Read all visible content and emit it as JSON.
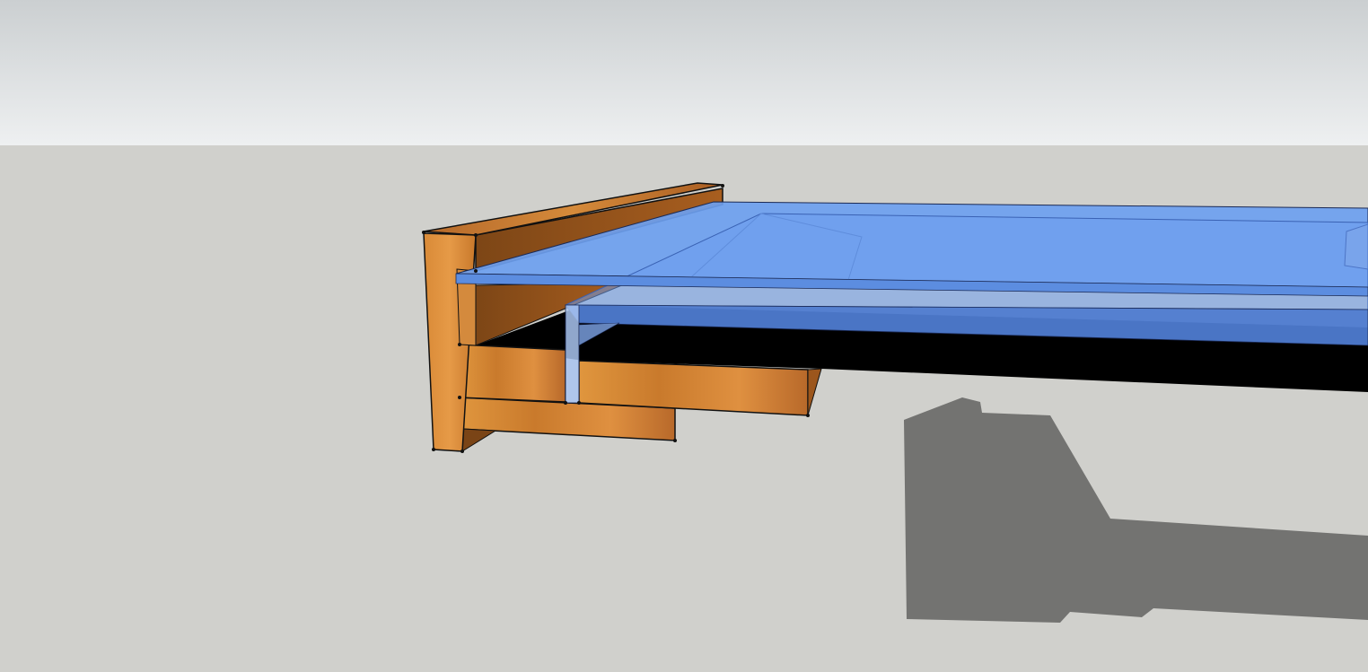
{
  "app": {
    "view": "3d-model-viewport"
  },
  "scene": {
    "objects": [
      "wooden-bracket",
      "glass-shelf",
      "shadow"
    ]
  },
  "colors": {
    "sky_top": "#cbcfd1",
    "sky_bottom": "#eef0f1",
    "ground": "#d0d0cc",
    "wood_light": "#e0953f",
    "wood_mid": "#c97a2c",
    "wood_dark": "#8a4c18",
    "glass_top": "#6d9ff0",
    "glass_edge": "#5585d8",
    "glass_underside": "#4b74c8",
    "shadow": "#737371",
    "edge": "#111111"
  }
}
